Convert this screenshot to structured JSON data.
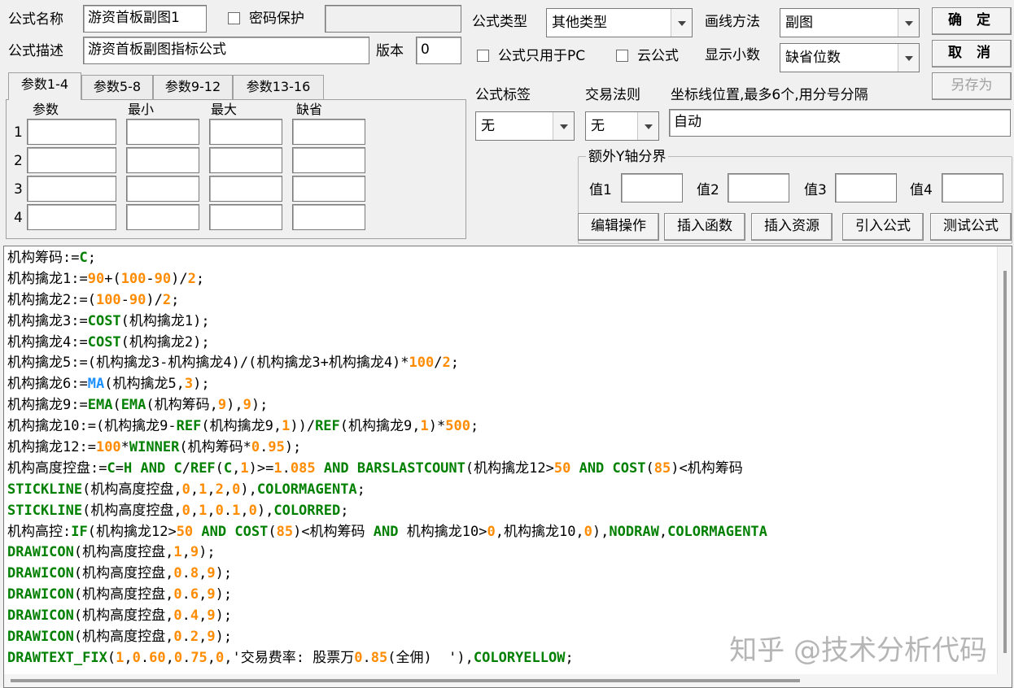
{
  "form": {
    "name_label": "公式名称",
    "name_value": "游资首板副图1",
    "password_label": "密码保护",
    "password_value": "",
    "desc_label": "公式描述",
    "desc_value": "游资首板副图指标公式",
    "version_label": "版本",
    "version_value": "0",
    "type_label": "公式类型",
    "type_value": "其他类型",
    "draw_method_label": "画线方法",
    "draw_method_value": "副图",
    "pc_only_label": "公式只用于PC",
    "cloud_label": "云公式",
    "decimals_label": "显示小数",
    "decimals_value": "缺省位数",
    "tag_label": "公式标签",
    "tag_value": "无",
    "trade_rule_label": "交易法则",
    "trade_rule_value": "无",
    "axis_label": "坐标线位置,最多6个,用分号分隔",
    "axis_value": "自动",
    "extra_y_label": "额外Y轴分界",
    "extra_y": [
      {
        "label": "值1",
        "value": ""
      },
      {
        "label": "值2",
        "value": ""
      },
      {
        "label": "值3",
        "value": ""
      },
      {
        "label": "值4",
        "value": ""
      }
    ]
  },
  "buttons": {
    "ok": "确 定",
    "cancel": "取 消",
    "save_as": "另存为",
    "edit_ops": "编辑操作",
    "insert_func": "插入函数",
    "insert_res": "插入资源",
    "import_formula": "引入公式",
    "test_formula": "测试公式"
  },
  "tabs": [
    "参数1-4",
    "参数5-8",
    "参数9-12",
    "参数13-16"
  ],
  "params": {
    "headers": [
      "参数",
      "最小",
      "最大",
      "缺省"
    ],
    "rows": [
      "1",
      "2",
      "3",
      "4"
    ]
  },
  "code_colors": {
    "default": "#000000",
    "keyword": "#008000",
    "number": "#ff8c00",
    "ma": "#1e90ff"
  },
  "code_lines": [
    [
      [
        "机构筹码:=",
        "def"
      ],
      [
        "C",
        "kw"
      ],
      [
        ";",
        "def"
      ]
    ],
    [
      [
        "机构擒龙1:=",
        "def"
      ],
      [
        "90",
        "num"
      ],
      [
        "+(",
        "def"
      ],
      [
        "100",
        "num"
      ],
      [
        "-",
        "def"
      ],
      [
        "90",
        "num"
      ],
      [
        ")/",
        "def"
      ],
      [
        "2",
        "num"
      ],
      [
        ";",
        "def"
      ]
    ],
    [
      [
        "机构擒龙2:=(",
        "def"
      ],
      [
        "100",
        "num"
      ],
      [
        "-",
        "def"
      ],
      [
        "90",
        "num"
      ],
      [
        ")/",
        "def"
      ],
      [
        "2",
        "num"
      ],
      [
        ";",
        "def"
      ]
    ],
    [
      [
        "机构擒龙3:=",
        "def"
      ],
      [
        "COST",
        "kw"
      ],
      [
        "(机构擒龙1);",
        "def"
      ]
    ],
    [
      [
        "机构擒龙4:=",
        "def"
      ],
      [
        "COST",
        "kw"
      ],
      [
        "(机构擒龙2);",
        "def"
      ]
    ],
    [
      [
        "机构擒龙5:=(机构擒龙3-机构擒龙4)/(机构擒龙3+机构擒龙4)*",
        "def"
      ],
      [
        "100",
        "num"
      ],
      [
        "/",
        "def"
      ],
      [
        "2",
        "num"
      ],
      [
        ";",
        "def"
      ]
    ],
    [
      [
        "机构擒龙6:=",
        "def"
      ],
      [
        "MA",
        "ma"
      ],
      [
        "(机构擒龙5,",
        "def"
      ],
      [
        "3",
        "num"
      ],
      [
        ");",
        "def"
      ]
    ],
    [
      [
        "机构擒龙9:=",
        "def"
      ],
      [
        "EMA",
        "kw"
      ],
      [
        "(",
        "def"
      ],
      [
        "EMA",
        "kw"
      ],
      [
        "(机构筹码,",
        "def"
      ],
      [
        "9",
        "num"
      ],
      [
        "),",
        "def"
      ],
      [
        "9",
        "num"
      ],
      [
        ");",
        "def"
      ]
    ],
    [
      [
        "机构擒龙10:=(机构擒龙9-",
        "def"
      ],
      [
        "REF",
        "kw"
      ],
      [
        "(机构擒龙9,",
        "def"
      ],
      [
        "1",
        "num"
      ],
      [
        "))/",
        "def"
      ],
      [
        "REF",
        "kw"
      ],
      [
        "(机构擒龙9,",
        "def"
      ],
      [
        "1",
        "num"
      ],
      [
        ")*",
        "def"
      ],
      [
        "500",
        "num"
      ],
      [
        ";",
        "def"
      ]
    ],
    [
      [
        "机构擒龙12:=",
        "def"
      ],
      [
        "100",
        "num"
      ],
      [
        "*",
        "def"
      ],
      [
        "WINNER",
        "kw"
      ],
      [
        "(机构筹码*",
        "def"
      ],
      [
        "0",
        "num"
      ],
      [
        ".",
        "def"
      ],
      [
        "95",
        "num"
      ],
      [
        ");",
        "def"
      ]
    ],
    [
      [
        "机构高度控盘:=",
        "def"
      ],
      [
        "C",
        "kw"
      ],
      [
        "=",
        "def"
      ],
      [
        "H",
        "kw"
      ],
      [
        " ",
        "def"
      ],
      [
        "AND",
        "kw"
      ],
      [
        " ",
        "def"
      ],
      [
        "C",
        "kw"
      ],
      [
        "/",
        "def"
      ],
      [
        "REF",
        "kw"
      ],
      [
        "(",
        "def"
      ],
      [
        "C",
        "kw"
      ],
      [
        ",",
        "def"
      ],
      [
        "1",
        "num"
      ],
      [
        ")>=",
        "def"
      ],
      [
        "1",
        "num"
      ],
      [
        ".",
        "def"
      ],
      [
        "085",
        "num"
      ],
      [
        " ",
        "def"
      ],
      [
        "AND",
        "kw"
      ],
      [
        " ",
        "def"
      ],
      [
        "BARSLASTCOUNT",
        "kw"
      ],
      [
        "(机构擒龙12>",
        "def"
      ],
      [
        "50",
        "num"
      ],
      [
        " ",
        "def"
      ],
      [
        "AND",
        "kw"
      ],
      [
        " ",
        "def"
      ],
      [
        "COST",
        "kw"
      ],
      [
        "(",
        "def"
      ],
      [
        "85",
        "num"
      ],
      [
        ")<机构筹码",
        "def"
      ]
    ],
    [
      [
        "STICKLINE",
        "kw"
      ],
      [
        "(机构高度控盘,",
        "def"
      ],
      [
        "0",
        "num"
      ],
      [
        ",",
        "def"
      ],
      [
        "1",
        "num"
      ],
      [
        ",",
        "def"
      ],
      [
        "2",
        "num"
      ],
      [
        ",",
        "def"
      ],
      [
        "0",
        "num"
      ],
      [
        "),",
        "def"
      ],
      [
        "COLORMAGENTA",
        "kw"
      ],
      [
        ";",
        "def"
      ]
    ],
    [
      [
        "STICKLINE",
        "kw"
      ],
      [
        "(机构高度控盘,",
        "def"
      ],
      [
        "0",
        "num"
      ],
      [
        ",",
        "def"
      ],
      [
        "1",
        "num"
      ],
      [
        ",",
        "def"
      ],
      [
        "0",
        "num"
      ],
      [
        ".",
        "def"
      ],
      [
        "1",
        "num"
      ],
      [
        ",",
        "def"
      ],
      [
        "0",
        "num"
      ],
      [
        "),",
        "def"
      ],
      [
        "COLORRED",
        "kw"
      ],
      [
        ";",
        "def"
      ]
    ],
    [
      [
        "机构高控:",
        "def"
      ],
      [
        "IF",
        "kw"
      ],
      [
        "(机构擒龙12>",
        "def"
      ],
      [
        "50",
        "num"
      ],
      [
        " ",
        "def"
      ],
      [
        "AND",
        "kw"
      ],
      [
        " ",
        "def"
      ],
      [
        "COST",
        "kw"
      ],
      [
        "(",
        "def"
      ],
      [
        "85",
        "num"
      ],
      [
        ")<机构筹码 ",
        "def"
      ],
      [
        "AND",
        "kw"
      ],
      [
        " 机构擒龙10>",
        "def"
      ],
      [
        "0",
        "num"
      ],
      [
        ",机构擒龙10,",
        "def"
      ],
      [
        "0",
        "num"
      ],
      [
        "),",
        "def"
      ],
      [
        "NODRAW",
        "kw"
      ],
      [
        ",",
        "def"
      ],
      [
        "COLORMAGENTA",
        "kw"
      ]
    ],
    [
      [
        "DRAWICON",
        "kw"
      ],
      [
        "(机构高度控盘,",
        "def"
      ],
      [
        "1",
        "num"
      ],
      [
        ",",
        "def"
      ],
      [
        "9",
        "num"
      ],
      [
        ");",
        "def"
      ]
    ],
    [
      [
        "DRAWICON",
        "kw"
      ],
      [
        "(机构高度控盘,",
        "def"
      ],
      [
        "0",
        "num"
      ],
      [
        ".",
        "def"
      ],
      [
        "8",
        "num"
      ],
      [
        ",",
        "def"
      ],
      [
        "9",
        "num"
      ],
      [
        ");",
        "def"
      ]
    ],
    [
      [
        "DRAWICON",
        "kw"
      ],
      [
        "(机构高度控盘,",
        "def"
      ],
      [
        "0",
        "num"
      ],
      [
        ".",
        "def"
      ],
      [
        "6",
        "num"
      ],
      [
        ",",
        "def"
      ],
      [
        "9",
        "num"
      ],
      [
        ");",
        "def"
      ]
    ],
    [
      [
        "DRAWICON",
        "kw"
      ],
      [
        "(机构高度控盘,",
        "def"
      ],
      [
        "0",
        "num"
      ],
      [
        ".",
        "def"
      ],
      [
        "4",
        "num"
      ],
      [
        ",",
        "def"
      ],
      [
        "9",
        "num"
      ],
      [
        ");",
        "def"
      ]
    ],
    [
      [
        "DRAWICON",
        "kw"
      ],
      [
        "(机构高度控盘,",
        "def"
      ],
      [
        "0",
        "num"
      ],
      [
        ".",
        "def"
      ],
      [
        "2",
        "num"
      ],
      [
        ",",
        "def"
      ],
      [
        "9",
        "num"
      ],
      [
        ");",
        "def"
      ]
    ],
    [
      [
        "DRAWTEXT_FIX",
        "kw"
      ],
      [
        "(",
        "def"
      ],
      [
        "1",
        "num"
      ],
      [
        ",",
        "def"
      ],
      [
        "0",
        "num"
      ],
      [
        ".",
        "def"
      ],
      [
        "60",
        "num"
      ],
      [
        ",",
        "def"
      ],
      [
        "0",
        "num"
      ],
      [
        ".",
        "def"
      ],
      [
        "75",
        "num"
      ],
      [
        ",",
        "def"
      ],
      [
        "0",
        "num"
      ],
      [
        ",'交易费率: 股票万",
        "def"
      ],
      [
        "0",
        "num"
      ],
      [
        ".",
        "def"
      ],
      [
        "85",
        "num"
      ],
      [
        "(全佣)  '),",
        "def"
      ],
      [
        "COLORYELLOW",
        "kw"
      ],
      [
        ";",
        "def"
      ]
    ]
  ],
  "watermark": "知乎 @技术分析代码"
}
